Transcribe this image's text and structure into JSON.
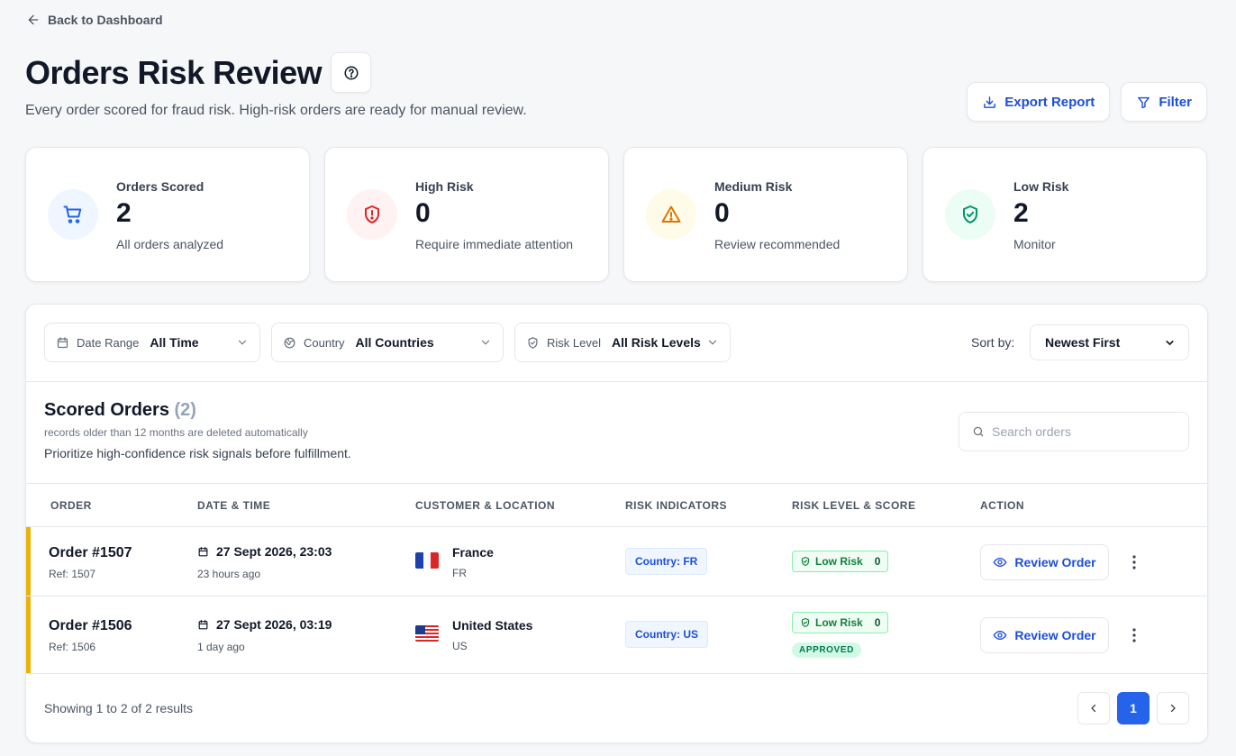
{
  "nav": {
    "back_label": "Back to Dashboard"
  },
  "header": {
    "title": "Orders Risk Review",
    "subtitle": "Every order scored for fraud risk. High-risk orders are ready for manual review.",
    "export_label": "Export Report",
    "filter_label": "Filter"
  },
  "stats": [
    {
      "label": "Orders Scored",
      "value": "2",
      "desc": "All orders analyzed",
      "icon": "cart-icon",
      "color": "#2563eb",
      "bg": "#eff6ff"
    },
    {
      "label": "High Risk",
      "value": "0",
      "desc": "Require immediate attention",
      "icon": "shield-alert-icon",
      "color": "#dc2626",
      "bg": "#fef2f2"
    },
    {
      "label": "Medium Risk",
      "value": "0",
      "desc": "Review recommended",
      "icon": "warning-icon",
      "color": "#d97706",
      "bg": "#fefce8"
    },
    {
      "label": "Low Risk",
      "value": "2",
      "desc": "Monitor",
      "icon": "shield-check-icon",
      "color": "#059669",
      "bg": "#ecfdf5"
    }
  ],
  "filters": {
    "date": {
      "label": "Date Range",
      "value": "All Time"
    },
    "country": {
      "label": "Country",
      "value": "All Countries"
    },
    "risk": {
      "label": "Risk Level",
      "value": "All Risk Levels"
    },
    "sort_label": "Sort by:",
    "sort_value": "Newest First"
  },
  "list": {
    "title": "Scored Orders",
    "count": "(2)",
    "note": "records older than 12 months are deleted automatically",
    "subtitle": "Prioritize high-confidence risk signals before fulfillment.",
    "search_placeholder": "Search orders"
  },
  "columns": [
    "ORDER",
    "DATE & TIME",
    "CUSTOMER & LOCATION",
    "RISK INDICATORS",
    "RISK LEVEL & SCORE",
    "ACTION"
  ],
  "orders": [
    {
      "id": "Order #1507",
      "ref": "Ref: 1507",
      "datetime": "27 Sept 2026, 23:03",
      "ago": "23 hours ago",
      "country": "France",
      "code": "FR",
      "flag": "fr",
      "indicator": "Country: FR",
      "risk": "Low Risk",
      "score": "0",
      "status": "",
      "action": "Review Order"
    },
    {
      "id": "Order #1506",
      "ref": "Ref: 1506",
      "datetime": "27 Sept 2026, 03:19",
      "ago": "1 day ago",
      "country": "United States",
      "code": "US",
      "flag": "us",
      "indicator": "Country: US",
      "risk": "Low Risk",
      "score": "0",
      "status": "APPROVED",
      "action": "Review Order"
    }
  ],
  "pagination": {
    "summary": "Showing 1 to 2 of 2 results",
    "current": "1"
  },
  "colors": {
    "accent": "#2563eb",
    "row_marker": "#eab308",
    "low_risk": "#15803d"
  }
}
